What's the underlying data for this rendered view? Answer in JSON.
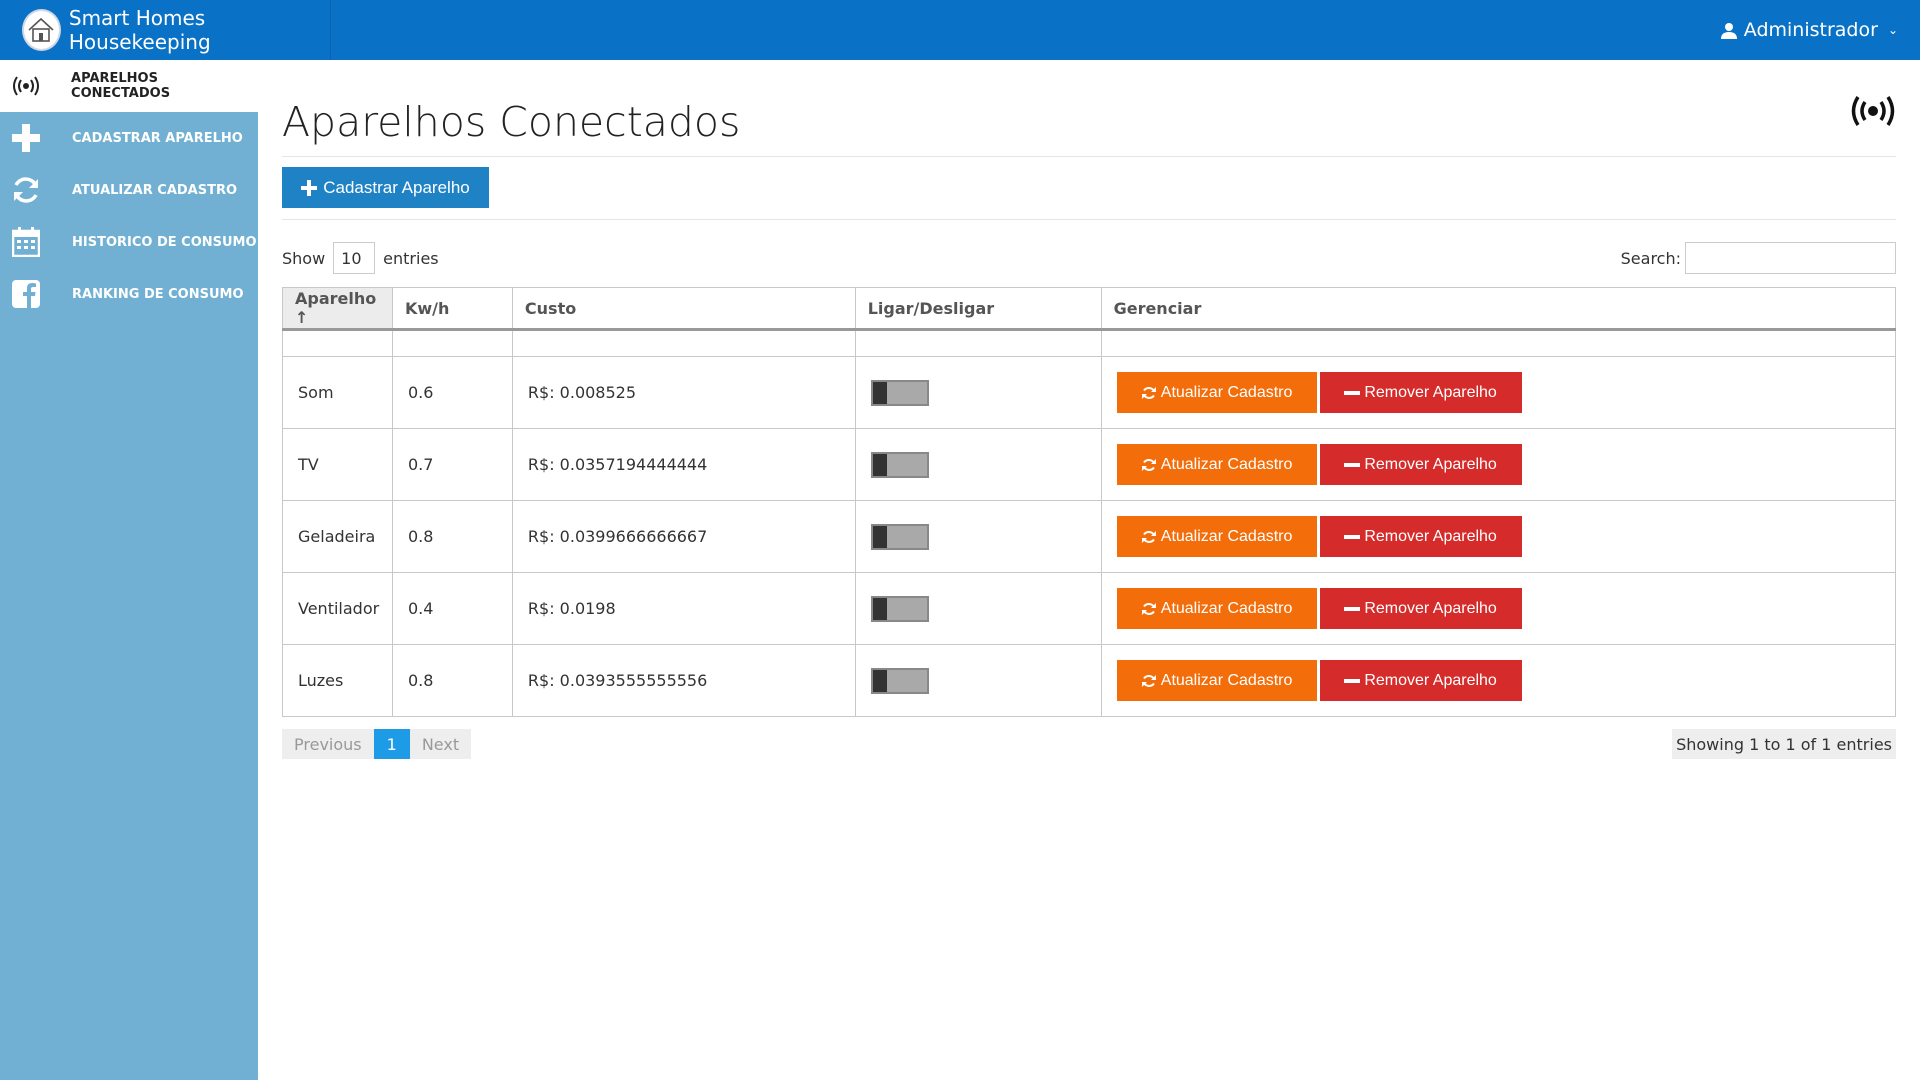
{
  "header": {
    "app_title": "Smart Homes Housekeeping",
    "user_label": "Administrador"
  },
  "sidebar": {
    "items": [
      {
        "label": "APARELHOS CONECTADOS",
        "icon": "radio-waves-icon",
        "active": true
      },
      {
        "label": "CADASTRAR APARELHO",
        "icon": "plus-icon"
      },
      {
        "label": "ATUALIZAR CADASTRO",
        "icon": "refresh-icon"
      },
      {
        "label": "HISTORICO DE CONSUMO",
        "icon": "calendar-icon"
      },
      {
        "label": "RANKING DE CONSUMO",
        "icon": "facebook-icon"
      }
    ]
  },
  "main": {
    "title": "Aparelhos Conectados",
    "add_button": "Cadastrar Aparelho",
    "show_label": "Show",
    "show_value": "10",
    "entries_label": "entries",
    "search_label": "Search:",
    "search_value": ""
  },
  "table": {
    "headers": [
      "Aparelho ↑",
      "Kw/h",
      "Custo",
      "Ligar/Desligar",
      "Gerenciar"
    ],
    "rows": [
      {
        "aparelho": "Som",
        "kwh": "0.6",
        "custo": "R$: 0.008525",
        "on": false
      },
      {
        "aparelho": "TV",
        "kwh": "0.7",
        "custo": "R$: 0.0357194444444",
        "on": false
      },
      {
        "aparelho": "Geladeira",
        "kwh": "0.8",
        "custo": "R$: 0.0399666666667",
        "on": false
      },
      {
        "aparelho": "Ventilador",
        "kwh": "0.4",
        "custo": "R$: 0.0198",
        "on": false
      },
      {
        "aparelho": "Luzes",
        "kwh": "0.8",
        "custo": "R$: 0.0393555555556",
        "on": false
      }
    ],
    "update_label": "Atualizar Cadastro",
    "remove_label": "Remover Aparelho"
  },
  "pagination": {
    "previous": "Previous",
    "current": "1",
    "next": "Next",
    "info": "Showing 1 to 1 of 1 entries"
  },
  "colors": {
    "topbar": "#0a72c6",
    "sidebar": "#71b0d3",
    "primary": "#1e82c5",
    "orange": "#f36e0a",
    "red": "#d52b2b"
  }
}
